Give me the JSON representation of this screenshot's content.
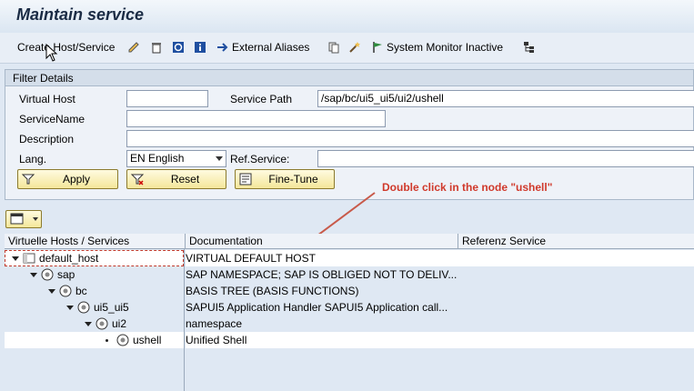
{
  "title": "Maintain service",
  "toolbar": {
    "create_label": "Create Host/Service",
    "external_aliases_label": "External Aliases",
    "system_monitor_label": "System Monitor Inactive"
  },
  "filter": {
    "group_title": "Filter Details",
    "virtual_host_label": "Virtual Host",
    "virtual_host_value": "",
    "service_path_label": "Service Path",
    "service_path_value": "/sap/bc/ui5_ui5/ui2/ushell",
    "service_name_label": "ServiceName",
    "service_name_value": "",
    "description_label": "Description",
    "description_value": "",
    "lang_label": "Lang.",
    "lang_value": "EN English",
    "ref_service_label": "Ref.Service:",
    "ref_service_value": "",
    "apply_label": "Apply",
    "reset_label": "Reset",
    "fine_tune_label": "Fine-Tune"
  },
  "annotation": "Double click in the node \"ushell\"",
  "tree": {
    "columns": [
      "Virtuelle Hosts / Services",
      "Documentation",
      "Referenz Service"
    ],
    "rows": [
      {
        "name": "default_host",
        "doc": "VIRTUAL DEFAULT HOST"
      },
      {
        "name": "sap",
        "doc": "SAP NAMESPACE; SAP IS OBLIGED NOT TO DELIV..."
      },
      {
        "name": "bc",
        "doc": "BASIS TREE (BASIS FUNCTIONS)"
      },
      {
        "name": "ui5_ui5",
        "doc": "SAPUI5 Application Handler SAPUI5 Application call..."
      },
      {
        "name": "ui2",
        "doc": "namespace"
      },
      {
        "name": "ushell",
        "doc": "Unified Shell"
      }
    ]
  },
  "colors": {
    "annotation": "#d0392b",
    "button_bg": "#f4e79a"
  }
}
